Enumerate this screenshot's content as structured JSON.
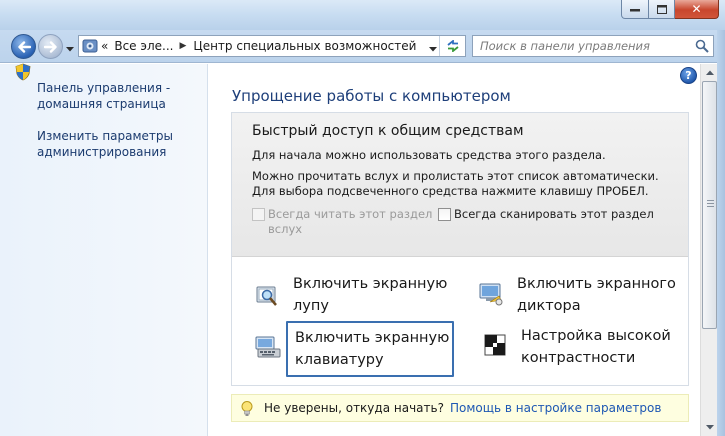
{
  "window": {
    "close_symbol": "✕"
  },
  "addressbar": {
    "crumb_prefix": "«",
    "crumb_1": "Все эле...",
    "crumb_2": "Центр специальных возможностей"
  },
  "search": {
    "placeholder": "Поиск в панели управления"
  },
  "sidebar": {
    "items": [
      {
        "label_line1": "Панель управления -",
        "label_line2": "домашняя страница"
      },
      {
        "label_line1": "Изменить параметры",
        "label_line2": "администрирования"
      }
    ]
  },
  "main": {
    "help_label": "?",
    "title": "Упрощение работы с компьютером",
    "quick_access": {
      "title": "Быстрый доступ к общим средствам",
      "desc1": "Для начала можно использовать средства этого раздела.",
      "desc2": "Можно прочитать вслух и пролистать этот список автоматически. Для выбора подсвеченного средства нажмите клавишу ПРОБЕЛ.",
      "checkbox_read": {
        "line1": "Всегда читать этот раздел",
        "line2": "вслух",
        "checked": false,
        "disabled": true
      },
      "checkbox_scan": {
        "label": "Всегда сканировать этот раздел",
        "checked": false
      }
    },
    "tools": [
      {
        "line1": "Включить экранную",
        "line2": "лупу"
      },
      {
        "line1": "Включить экранного",
        "line2": "диктора"
      },
      {
        "line1": "Включить экранную",
        "line2": "клавиатуру"
      },
      {
        "line1": "Настройка высокой",
        "line2": "контрастности"
      }
    ],
    "hint": {
      "text": "Не уверены, откуда начать?",
      "link": "Помощь в настройке параметров"
    }
  },
  "colors": {
    "link": "#1d57b3",
    "title": "#1e3f7a",
    "focus": "#3a6fb0"
  }
}
